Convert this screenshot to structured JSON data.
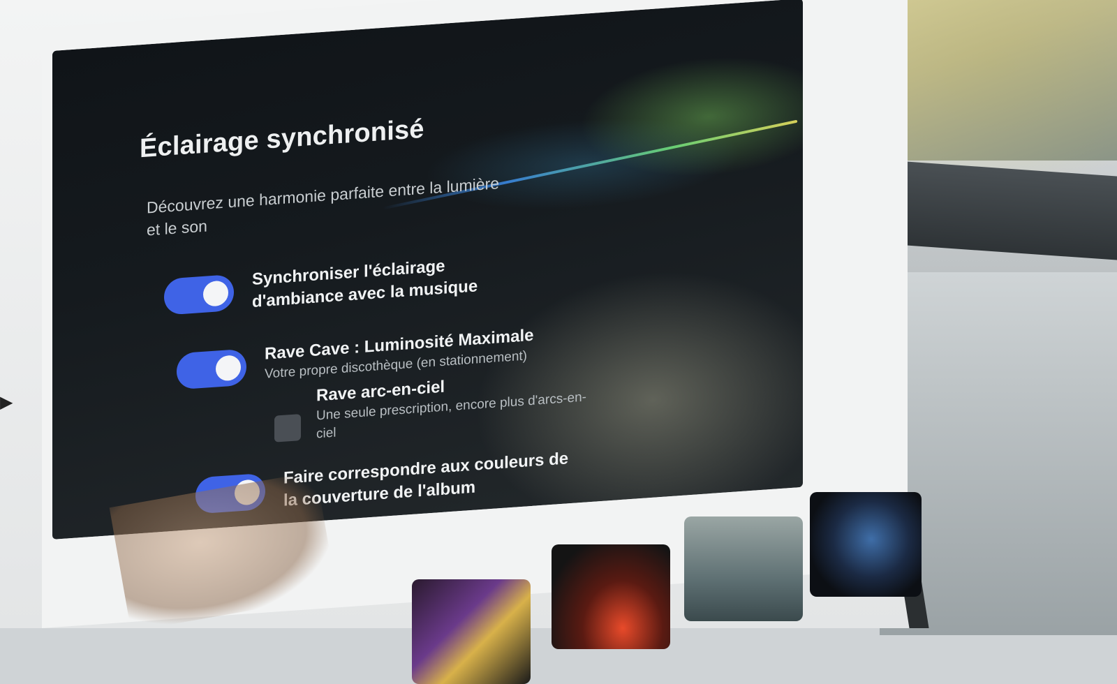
{
  "settings": {
    "title": "Éclairage synchronisé",
    "description": "Découvrez une harmonie parfaite entre la lumière et le son",
    "items": [
      {
        "label": "Synchroniser l'éclairage d'ambiance avec la musique",
        "enabled": true
      },
      {
        "label": "Rave Cave : Luminosité Maximale",
        "sublabel": "Votre propre discothèque (en stationnement)",
        "enabled": true
      },
      {
        "label": "Rave arc-en-ciel",
        "sublabel": "Une seule prescription, encore plus d'arcs-en-ciel",
        "checked": false
      },
      {
        "label": "Faire correspondre aux couleurs de la couverture de l'album",
        "enabled": true
      }
    ]
  },
  "colors": {
    "toggle_on": "#3f63e6",
    "panel_bg": "#151a1e"
  },
  "album_thumbnails": [
    "gold-sneakers-art",
    "red-neon-art",
    "car-on-road-art",
    "disco-ball-art"
  ]
}
